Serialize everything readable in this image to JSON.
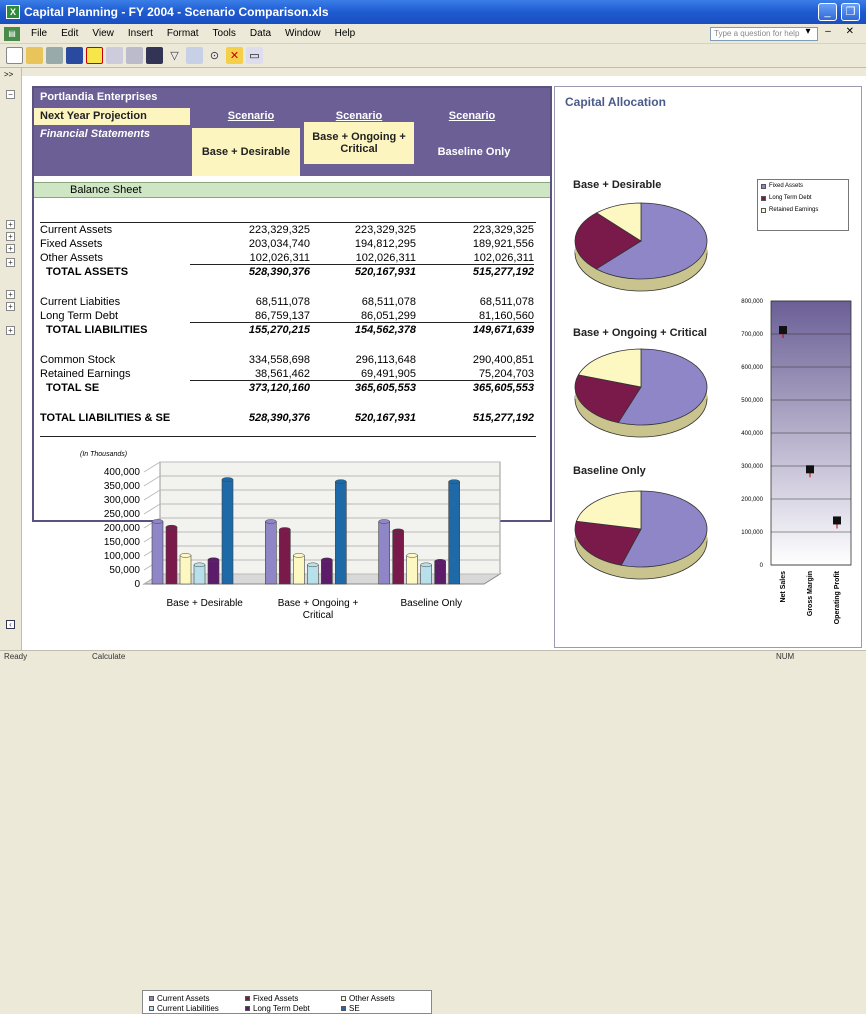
{
  "window": {
    "title": "Capital Planning - FY 2004 - Scenario Comparison.xls",
    "min": "_",
    "restore": "❐",
    "app_icon": "X"
  },
  "menu": [
    "File",
    "Edit",
    "View",
    "Insert",
    "Format",
    "Tools",
    "Data",
    "Window",
    "Help"
  ],
  "help_placeholder": "Type a question for help",
  "status": {
    "left": "Ready",
    "mid": "Calculate",
    "right": "NUM"
  },
  "gutter_top": ">>",
  "fin": {
    "company": "Portlandia Enterprises",
    "next_year": "Next Year Projection",
    "fin_statements": "Financial Statements",
    "scenario_label": "Scenario",
    "scenarios": [
      "Base + Desirable",
      "Base + Ongoing + Critical",
      "Baseline Only"
    ],
    "section": "Balance Sheet",
    "rows": [
      {
        "label": "Current Assets",
        "v": [
          "223,329,325",
          "223,329,325",
          "223,329,325"
        ]
      },
      {
        "label": "Fixed Assets",
        "v": [
          "203,034,740",
          "194,812,295",
          "189,921,556"
        ]
      },
      {
        "label": "Other Assets",
        "v": [
          "102,026,311",
          "102,026,311",
          "102,026,311"
        ]
      },
      {
        "label": "TOTAL ASSETS",
        "v": [
          "528,390,376",
          "520,167,931",
          "515,277,192"
        ]
      },
      {
        "label": "Current Liabities",
        "v": [
          "68,511,078",
          "68,511,078",
          "68,511,078"
        ]
      },
      {
        "label": "Long Term Debt",
        "v": [
          "86,759,137",
          "86,051,299",
          "81,160,560"
        ]
      },
      {
        "label": "TOTAL LIABILITIES",
        "v": [
          "155,270,215",
          "154,562,378",
          "149,671,639"
        ]
      },
      {
        "label": "Common Stock",
        "v": [
          "334,558,698",
          "296,113,648",
          "290,400,851"
        ]
      },
      {
        "label": "Retained Earnings",
        "v": [
          "38,561,462",
          "69,491,905",
          "75,204,703"
        ]
      },
      {
        "label": "TOTAL SE",
        "v": [
          "373,120,160",
          "365,605,553",
          "365,605,553"
        ]
      },
      {
        "label": "TOTAL LIABILITIES & SE",
        "v": [
          "528,390,376",
          "520,167,931",
          "515,277,192"
        ]
      }
    ]
  },
  "capital": {
    "title": "Capital Allocation",
    "pie_titles": [
      "Base + Desirable",
      "Base + Ongoing + Critical",
      "Baseline Only"
    ]
  },
  "chart_data": [
    {
      "type": "bar",
      "title": "",
      "ylabel": "(In Thousands)",
      "ylim": [
        0,
        400000
      ],
      "y_ticks": [
        "400,000",
        "350,000",
        "300,000",
        "250,000",
        "200,000",
        "150,000",
        "100,000",
        "50,000",
        "0"
      ],
      "categories": [
        "Base + Desirable",
        "Base + Ongoing + Critical",
        "Baseline Only"
      ],
      "series": [
        {
          "name": "Current Assets",
          "color": "#8f86c8",
          "values": [
            223329,
            223329,
            223329
          ]
        },
        {
          "name": "Fixed Assets",
          "color": "#7a1a4a",
          "values": [
            203035,
            194812,
            189922
          ]
        },
        {
          "name": "Other Assets",
          "color": "#fdf8c2",
          "values": [
            102026,
            102026,
            102026
          ]
        },
        {
          "name": "Current Liabilities",
          "color": "#b8e0ea",
          "values": [
            68511,
            68511,
            68511
          ]
        },
        {
          "name": "Long Term Debt",
          "color": "#5c1c6a",
          "values": [
            86759,
            86051,
            81161
          ]
        },
        {
          "name": "SE",
          "color": "#1e6aa8",
          "values": [
            373120,
            365606,
            365606
          ]
        }
      ],
      "legend": "bottom"
    },
    {
      "type": "pie",
      "title": "Base + Desirable",
      "legend": "top-right",
      "slices": [
        {
          "name": "Fixed Assets",
          "color": "#8f86c8",
          "value": 203035
        },
        {
          "name": "Long Term Debt",
          "color": "#7a1a4a",
          "value": 86759
        },
        {
          "name": "Retained Earnings",
          "color": "#fdf8c2",
          "value": 38561
        }
      ]
    },
    {
      "type": "pie",
      "title": "Base + Ongoing + Critical",
      "slices": [
        {
          "name": "Fixed Assets",
          "color": "#8f86c8",
          "value": 194812
        },
        {
          "name": "Long Term Debt",
          "color": "#7a1a4a",
          "value": 86051
        },
        {
          "name": "Retained Earnings",
          "color": "#fdf8c2",
          "value": 69492
        }
      ]
    },
    {
      "type": "pie",
      "title": "Baseline Only",
      "slices": [
        {
          "name": "Fixed Assets",
          "color": "#8f86c8",
          "value": 189922
        },
        {
          "name": "Long Term Debt",
          "color": "#7a1a4a",
          "value": 81161
        },
        {
          "name": "Retained Earnings",
          "color": "#fdf8c2",
          "value": 75205
        }
      ]
    },
    {
      "type": "scatter",
      "title": "",
      "ylim": [
        0,
        800000
      ],
      "y_ticks": [
        "800,000",
        "700,000",
        "600,000",
        "500,000",
        "400,000",
        "300,000",
        "200,000",
        "100,000",
        "0"
      ],
      "categories": [
        "Net Sales",
        "Gross Margin",
        "Operating Profit"
      ],
      "values": [
        712000,
        290000,
        135000
      ]
    }
  ]
}
